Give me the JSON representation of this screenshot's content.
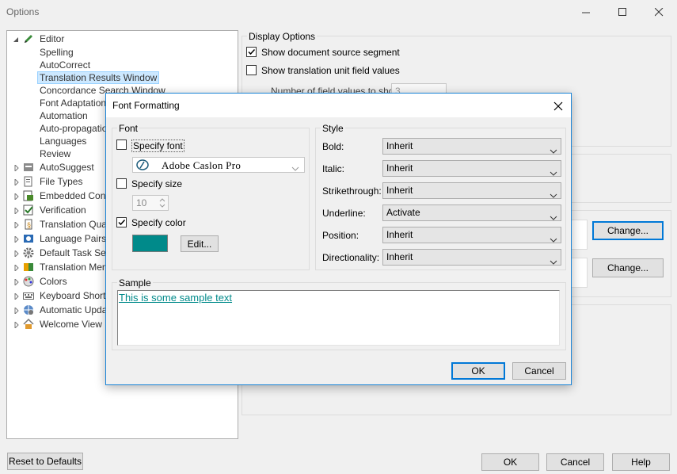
{
  "window": {
    "title": "Options",
    "minimize_label": "",
    "maximize_label": "",
    "close_label": ""
  },
  "tree": {
    "items": [
      {
        "label": "Editor",
        "icon": "pen-icon",
        "expanded": true
      },
      {
        "label": "Spelling"
      },
      {
        "label": "AutoCorrect"
      },
      {
        "label": "Translation Results Window",
        "selected": true
      },
      {
        "label": "Concordance Search Window"
      },
      {
        "label": "Font Adaptation"
      },
      {
        "label": "Automation"
      },
      {
        "label": "Auto-propagation"
      },
      {
        "label": "Languages"
      },
      {
        "label": "Review"
      },
      {
        "label": "AutoSuggest",
        "icon": "autosuggest-icon"
      },
      {
        "label": "File Types",
        "icon": "file-types-icon"
      },
      {
        "label": "Embedded Conte",
        "icon": "embedded-content-icon"
      },
      {
        "label": "Verification",
        "icon": "verification-icon"
      },
      {
        "label": "Translation Qual",
        "icon": "translation-quality-icon"
      },
      {
        "label": "Language Pairs",
        "icon": "language-pairs-icon"
      },
      {
        "label": "Default Task Sec",
        "icon": "gear-icon"
      },
      {
        "label": "Translation Mem",
        "icon": "translation-memory-icon"
      },
      {
        "label": "Colors",
        "icon": "palette-icon"
      },
      {
        "label": "Keyboard Shortc",
        "icon": "keyboard-icon"
      },
      {
        "label": "Automatic Update",
        "icon": "globe-update-icon"
      },
      {
        "label": "Welcome View",
        "icon": "house-icon"
      }
    ]
  },
  "display_options": {
    "title": "Display Options",
    "show_source_segment": "Show document source segment",
    "show_source_segment_checked": true,
    "show_tu_field_values": "Show translation unit field values",
    "show_tu_field_values_checked": false,
    "num_field_values_label": "Number of field values to show:",
    "num_field_values": "3"
  },
  "right_buttons": {
    "change_1": "Change...",
    "change_2": "Change..."
  },
  "bottom": {
    "reset": "Reset to Defaults",
    "ok": "OK",
    "cancel": "Cancel",
    "help": "Help"
  },
  "dialog": {
    "title": "Font Formatting",
    "font_group": "Font",
    "specify_font": "Specify font",
    "specify_font_checked": false,
    "font_name": "Adobe Caslon Pro",
    "specify_size": "Specify size",
    "specify_size_checked": false,
    "size_value": "10",
    "specify_color": "Specify color",
    "specify_color_checked": true,
    "color_swatch": "#008a8a",
    "edit_button": "Edit...",
    "style_group": "Style",
    "style_rows": [
      {
        "label": "Bold:",
        "value": "Inherit"
      },
      {
        "label": "Italic:",
        "value": "Inherit"
      },
      {
        "label": "Strikethrough:",
        "value": "Inherit"
      },
      {
        "label": "Underline:",
        "value": "Activate"
      },
      {
        "label": "Position:",
        "value": "Inherit"
      },
      {
        "label": "Directionality:",
        "value": "Inherit"
      }
    ],
    "sample_group": "Sample",
    "sample_text": "This is some sample text",
    "ok": "OK",
    "cancel": "Cancel"
  }
}
